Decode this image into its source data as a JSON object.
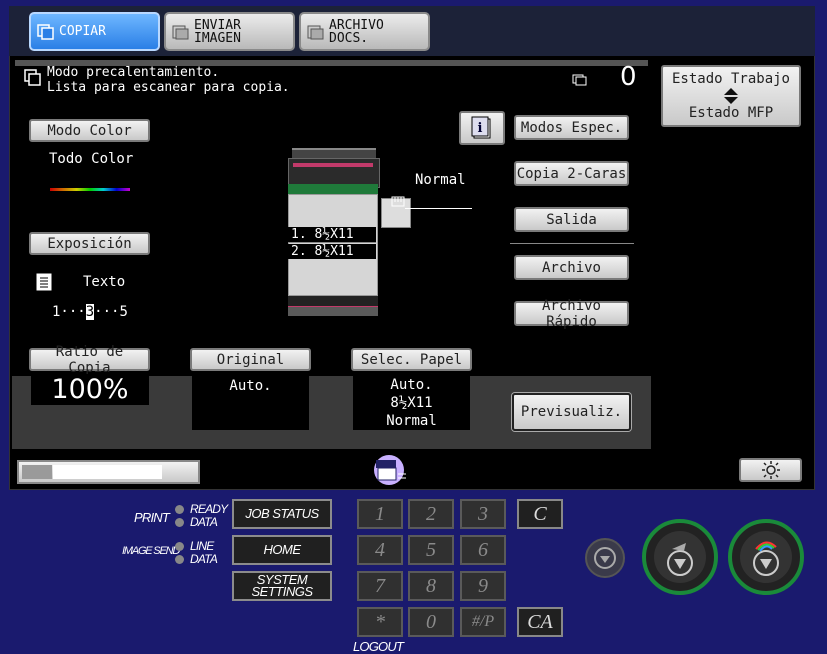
{
  "tabs": [
    {
      "label": "COPIAR",
      "active": true
    },
    {
      "label": "ENVIAR\nIMAGEN",
      "active": false
    },
    {
      "label": "ARCHIVO\nDOCS.",
      "active": false
    }
  ],
  "status": {
    "line1": "Modo precalentamiento.",
    "line2": "Lista para escanear para copia.",
    "count": "0"
  },
  "job": {
    "estado_trabajo": "Estado Trabajo",
    "estado_mfp": "Estado MFP"
  },
  "left": {
    "modo_color_btn": "Modo Color",
    "modo_color_value": "Todo Color",
    "exposicion_btn": "Exposición",
    "exposicion_mode": "Texto",
    "exposicion_scale_left": "1···",
    "exposicion_level": "3",
    "exposicion_scale_right": "···5"
  },
  "machine": {
    "output": "Normal",
    "tray1": "1. 8½X11",
    "tray2": "2. 8½X11"
  },
  "right_buttons": [
    "Modos Espec.",
    "Copia 2-Caras",
    "Salida",
    "Archivo",
    "Archivo Rápido"
  ],
  "bottom": {
    "ratio_btn": "Ratio de Copia",
    "ratio_value": "100%",
    "original_btn": "Original",
    "original_value": "Auto.",
    "papel_btn": "Selec. Papel",
    "papel_line1": "Auto.",
    "papel_line2": "8½X11",
    "papel_line3": "Normal",
    "preview_btn": "Previsualiz."
  },
  "panel": {
    "print_label": "PRINT",
    "ready": "READY",
    "data": "DATA",
    "image_send_label": "IMAGE SEND",
    "line": "LINE",
    "data2": "DATA",
    "job_status": "JOB STATUS",
    "home": "HOME",
    "system_settings": "SYSTEM\nSETTINGS",
    "logout": "LOGOUT",
    "keys": [
      "1",
      "2",
      "3",
      "4",
      "5",
      "6",
      "7",
      "8",
      "9",
      "*",
      "0",
      "#/P"
    ],
    "clear": "C",
    "clear_all": "CA"
  },
  "colors": {
    "accent_tab": "#2a7fe6",
    "bezel": "#1a1a6e"
  }
}
